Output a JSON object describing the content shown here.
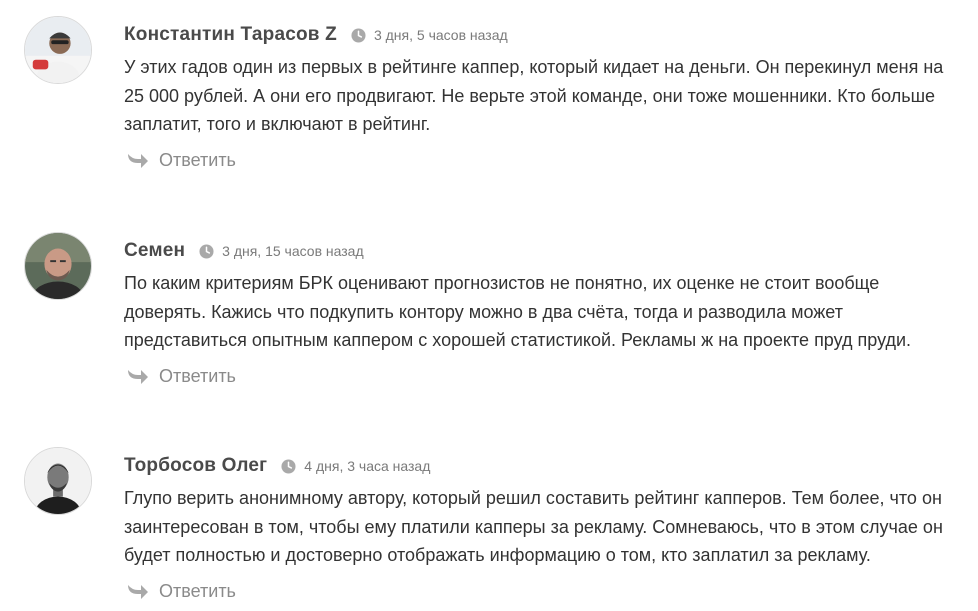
{
  "comments": [
    {
      "author": "Константин Тарасов Z",
      "time": "3 дня, 5 часов назад",
      "text": "У этих гадов один из первых в рейтинге каппер, который кидает на деньги. Он перекинул меня на 25 000 рублей. А они его продвигают. Не верьте этой команде, они тоже мошенники. Кто больше заплатит, того и включают в рейтинг.",
      "reply_label": "Ответить"
    },
    {
      "author": "Семен",
      "time": "3 дня, 15 часов назад",
      "text": "По каким критериям БРК оценивают прогнозистов не понятно, их оценке не стоит вообще доверять. Кажись что подкупить контору можно в два счёта, тогда и разводила может представиться опытным каппером с хорошей статистикой. Рекламы ж на проекте пруд пруди.",
      "reply_label": "Ответить"
    },
    {
      "author": "Торбосов Олег",
      "time": "4 дня, 3 часа назад",
      "text": "Глупо верить анонимному автору, который решил составить рейтинг капперов. Тем более, что он заинтересован в том, чтобы ему платили капперы за рекламу. Сомневаюсь, что в этом случае он будет полностью и достоверно отображать информацию о том, кто заплатил за рекламу.",
      "reply_label": "Ответить"
    }
  ],
  "icons": {
    "clock": "clock-icon",
    "reply": "reply-arrow-icon",
    "avatar": "user-avatar"
  },
  "colors": {
    "author": "#4a4a4a",
    "text": "#333333",
    "meta": "#7a7a7a",
    "reply": "#8a8a8a",
    "icon": "#a9a9a9"
  }
}
